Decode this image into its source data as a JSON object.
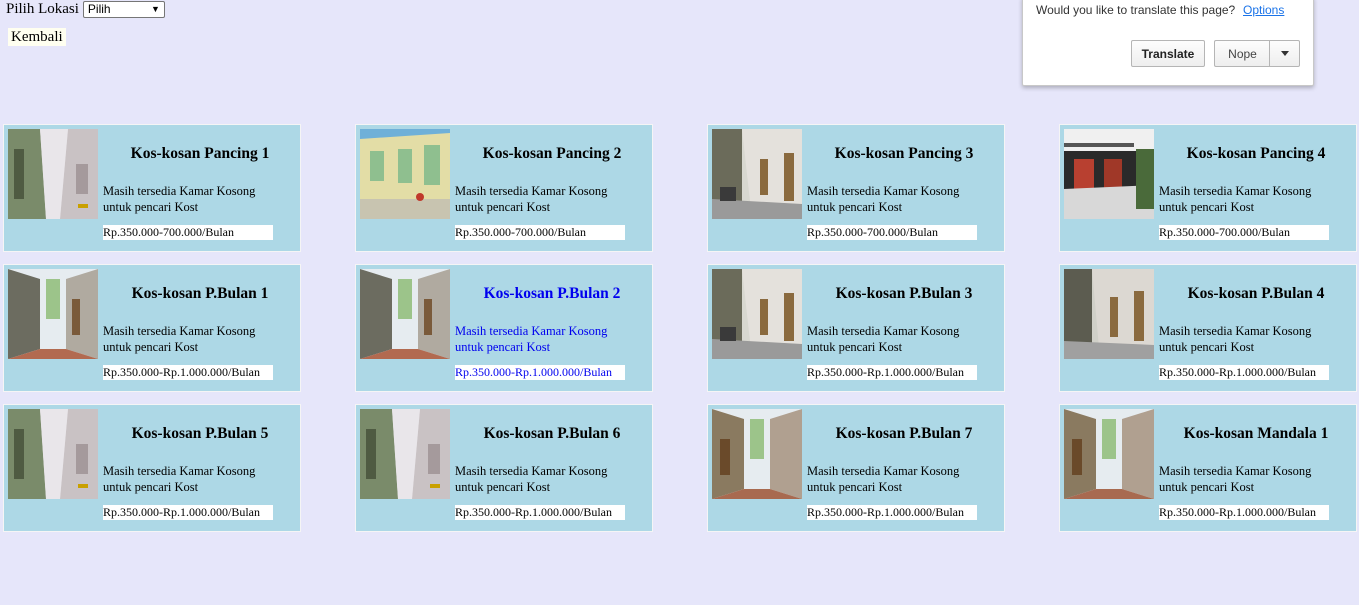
{
  "location": {
    "label": "Pilih Lokasi",
    "selected": "Pilih"
  },
  "back_label": "Kembali",
  "translate_bar": {
    "message": "Would you like to translate this page?",
    "options_label": "Options",
    "translate_label": "Translate",
    "nope_label": "Nope"
  },
  "listings": [
    {
      "title": "Kos-kosan Pancing 1",
      "desc_line1": "Masih tersedia Kamar Kosong",
      "desc_line2": "untuk pencari Kost",
      "price": "Rp.350.000-700.000/Bulan"
    },
    {
      "title": "Kos-kosan Pancing 2",
      "desc_line1": "Masih tersedia Kamar Kosong",
      "desc_line2": "untuk pencari Kost",
      "price": "Rp.350.000-700.000/Bulan"
    },
    {
      "title": "Kos-kosan Pancing 3",
      "desc_line1": "Masih tersedia Kamar Kosong",
      "desc_line2": "untuk pencari Kost",
      "price": "Rp.350.000-700.000/Bulan"
    },
    {
      "title": "Kos-kosan Pancing 4",
      "desc_line1": "Masih tersedia Kamar Kosong",
      "desc_line2": "untuk pencari Kost",
      "price": "Rp.350.000-700.000/Bulan"
    },
    {
      "title": "Kos-kosan P.Bulan 1",
      "desc_line1": "Masih tersedia Kamar Kosong",
      "desc_line2": "untuk pencari Kost",
      "price": "Rp.350.000-Rp.1.000.000/Bulan"
    },
    {
      "title": "Kos-kosan P.Bulan 2",
      "desc_line1": "Masih tersedia Kamar Kosong",
      "desc_line2": "untuk pencari Kost",
      "price": "Rp.350.000-Rp.1.000.000/Bulan"
    },
    {
      "title": "Kos-kosan P.Bulan 3",
      "desc_line1": "Masih tersedia Kamar Kosong",
      "desc_line2": "untuk pencari Kost",
      "price": "Rp.350.000-Rp.1.000.000/Bulan"
    },
    {
      "title": "Kos-kosan P.Bulan 4",
      "desc_line1": "Masih tersedia Kamar Kosong",
      "desc_line2": "untuk pencari Kost",
      "price": "Rp.350.000-Rp.1.000.000/Bulan"
    },
    {
      "title": "Kos-kosan P.Bulan 5",
      "desc_line1": "Masih tersedia Kamar Kosong",
      "desc_line2": "untuk pencari Kost",
      "price": "Rp.350.000-Rp.1.000.000/Bulan"
    },
    {
      "title": "Kos-kosan P.Bulan 6",
      "desc_line1": "Masih tersedia Kamar Kosong",
      "desc_line2": "untuk pencari Kost",
      "price": "Rp.350.000-Rp.1.000.000/Bulan"
    },
    {
      "title": "Kos-kosan P.Bulan 7",
      "desc_line1": "Masih tersedia Kamar Kosong",
      "desc_line2": "untuk pencari Kost",
      "price": "Rp.350.000-Rp.1.000.000/Bulan"
    },
    {
      "title": "Kos-kosan Mandala 1",
      "desc_line1": "Masih tersedia Kamar Kosong",
      "desc_line2": "untuk pencari Kost",
      "price": "Rp.350.000-Rp.1.000.000/Bulan"
    }
  ]
}
